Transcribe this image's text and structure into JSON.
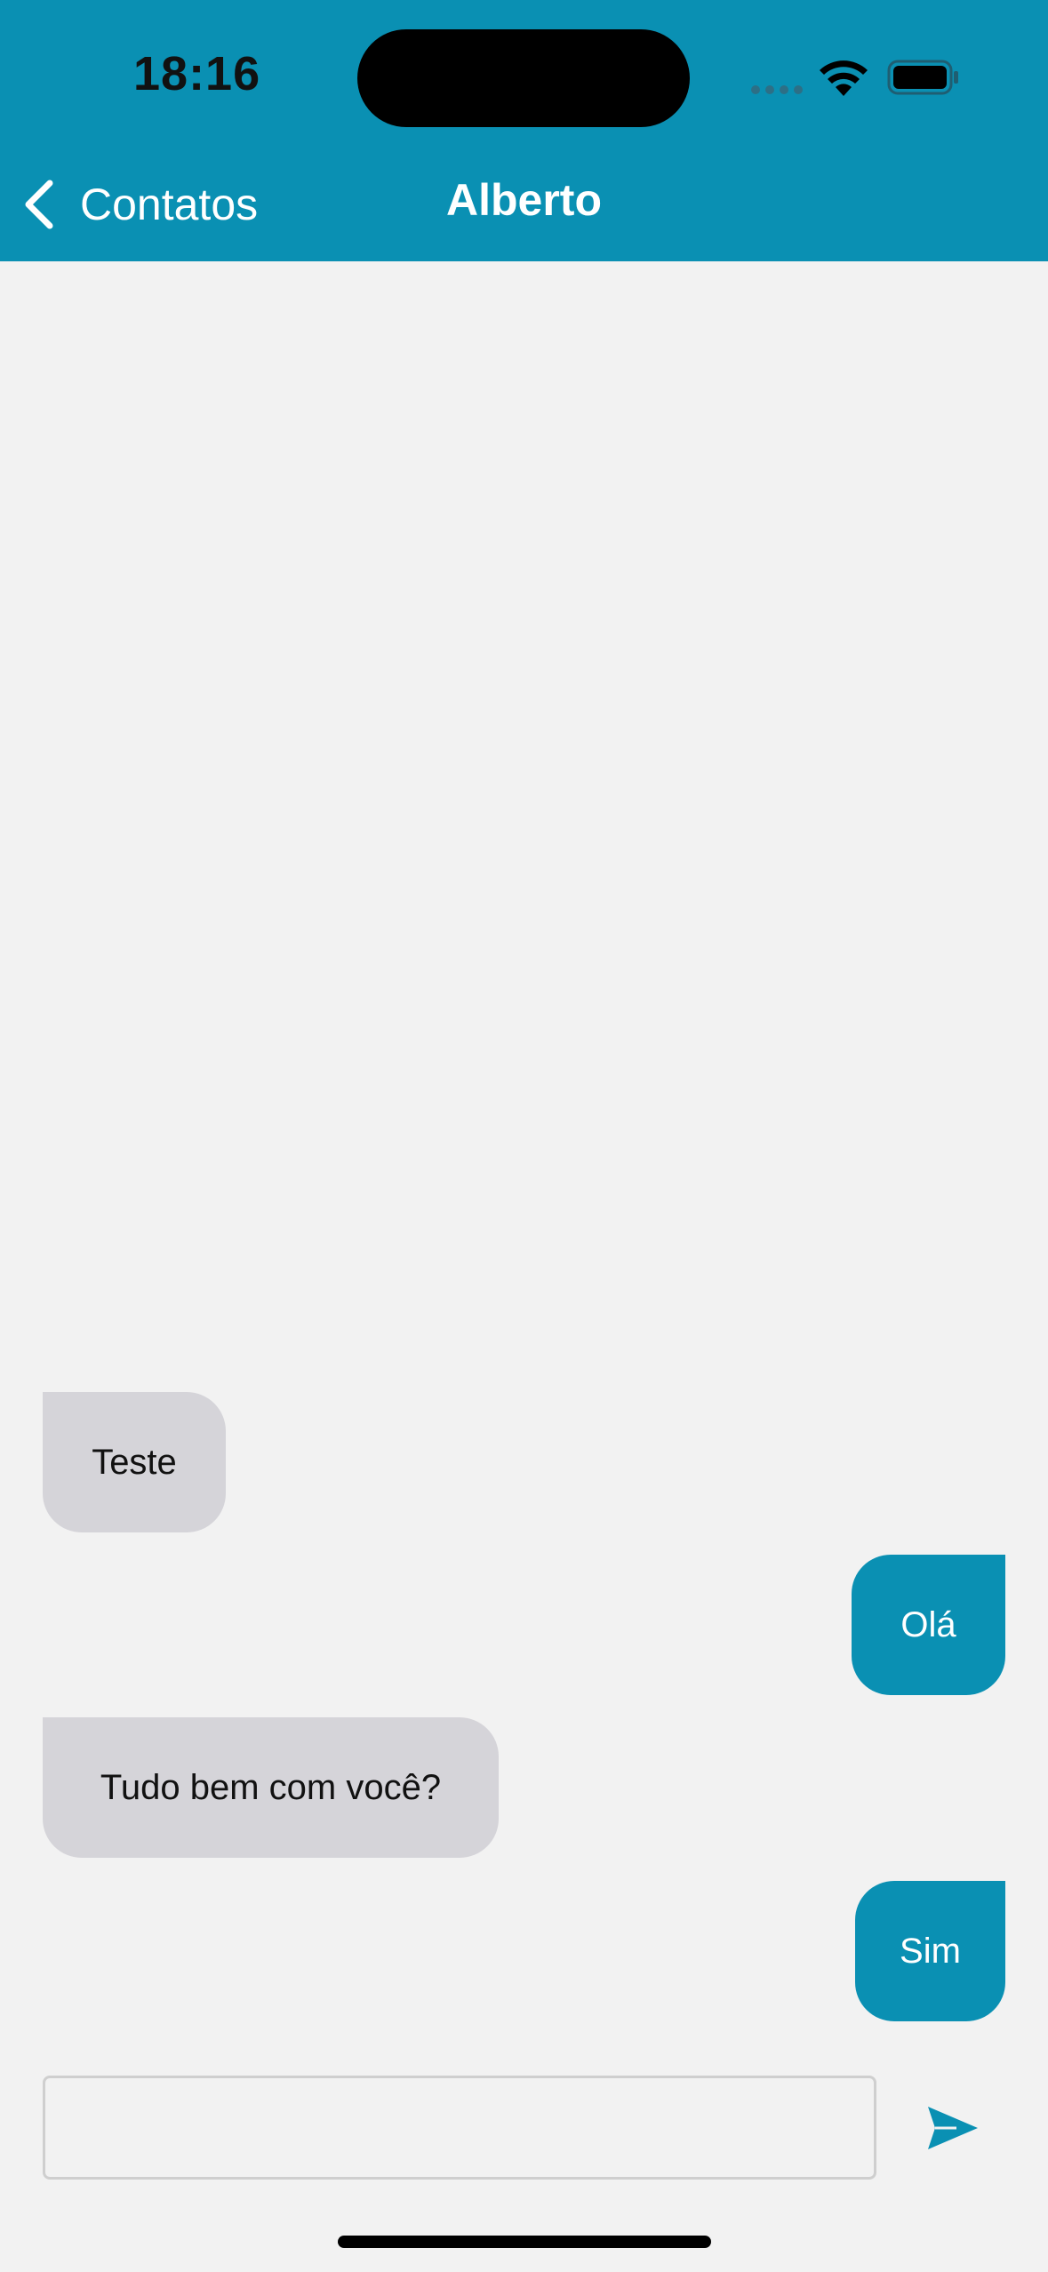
{
  "status_bar": {
    "time": "18:16"
  },
  "nav": {
    "back_label": "Contatos",
    "title": "Alberto"
  },
  "colors": {
    "accent": "#0a90b3",
    "received_bubble": "#d5d4d9",
    "background": "#f2f2f2"
  },
  "messages": [
    {
      "text": "Teste",
      "direction": "received"
    },
    {
      "text": "Olá",
      "direction": "sent"
    },
    {
      "text": "Tudo bem com você?",
      "direction": "received"
    },
    {
      "text": "Sim",
      "direction": "sent"
    }
  ],
  "composer": {
    "value": "",
    "placeholder": "",
    "send_icon": "send-icon"
  }
}
